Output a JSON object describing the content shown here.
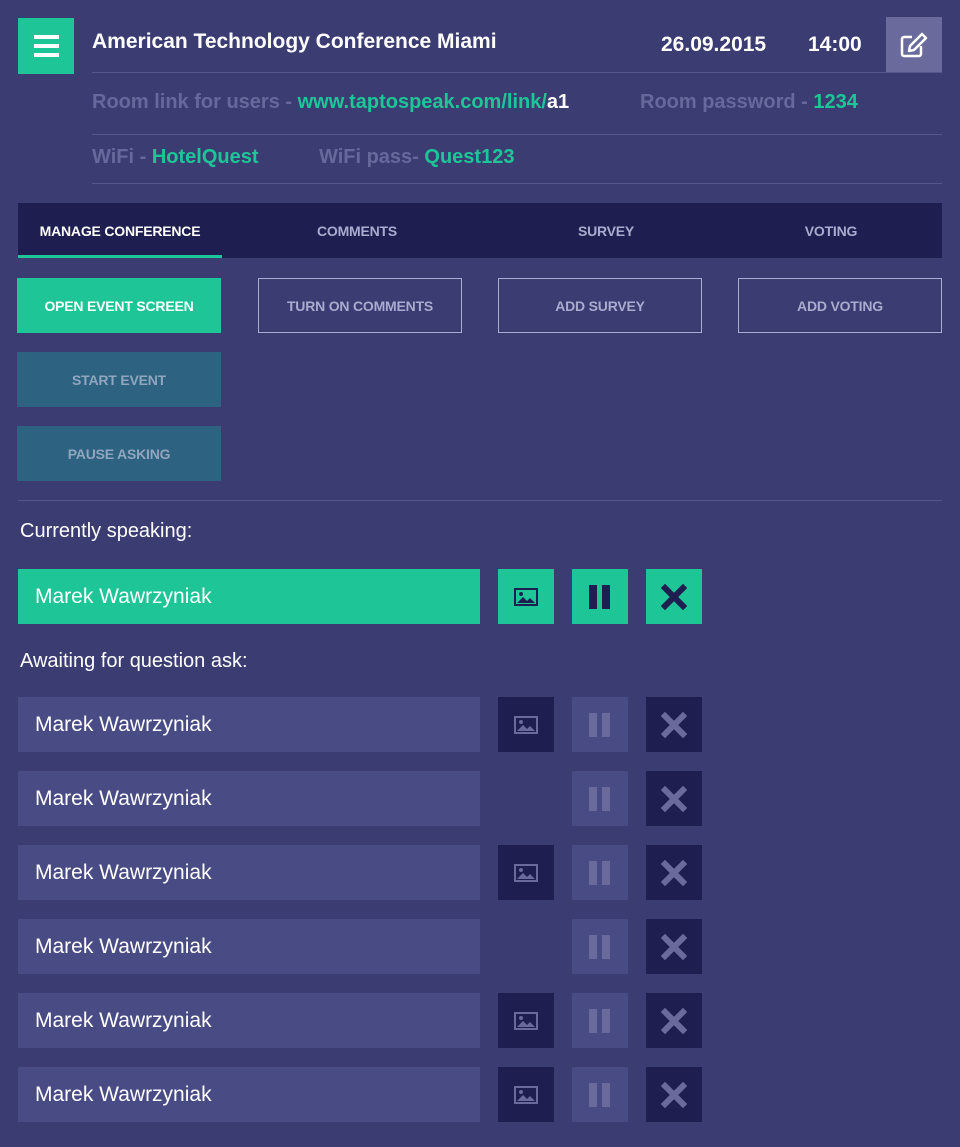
{
  "header": {
    "title": "American Technology Conference Miami",
    "date": "26.09.2015",
    "time": "14:00"
  },
  "info": {
    "room_link_label": "Room link for users - ",
    "room_link_url": "www.taptospeak.com/link/",
    "room_link_id": "a1",
    "room_password_label": "Room password - ",
    "room_password": "1234",
    "wifi_label": "WiFi - ",
    "wifi_name": "HotelQuest",
    "wifi_pass_label": "WiFi pass- ",
    "wifi_pass": "Quest123"
  },
  "tabs": [
    {
      "label": "MANAGE CONFERENCE",
      "active": true
    },
    {
      "label": "COMMENTS",
      "active": false
    },
    {
      "label": "SURVEY",
      "active": false
    },
    {
      "label": "VOTING",
      "active": false
    }
  ],
  "actions": {
    "open_event_screen": "OPEN EVENT SCREEN",
    "turn_on_comments": "TURN ON COMMENTS",
    "add_survey": "ADD SURVEY",
    "add_voting": "ADD VOTING",
    "start_event": "START EVENT",
    "pause_asking": "PAUSE ASKING"
  },
  "currently_speaking": {
    "label": "Currently speaking:",
    "name": "Marek Wawrzyniak"
  },
  "awaiting": {
    "label": "Awaiting for question ask:",
    "items": [
      {
        "name": "Marek Wawrzyniak",
        "has_image": true
      },
      {
        "name": "Marek Wawrzyniak",
        "has_image": false
      },
      {
        "name": "Marek Wawrzyniak",
        "has_image": true
      },
      {
        "name": "Marek Wawrzyniak",
        "has_image": false
      },
      {
        "name": "Marek Wawrzyniak",
        "has_image": true
      },
      {
        "name": "Marek Wawrzyniak",
        "has_image": true
      }
    ]
  },
  "icons": {
    "menu": "hamburger-menu-icon",
    "edit": "pencil-square-icon",
    "image": "image-icon",
    "pause": "pause-icon",
    "close": "close-icon"
  },
  "colors": {
    "background": "#3b3c72",
    "accent": "#1ec697",
    "dark": "#1e1f50",
    "row": "#494b84",
    "muted": "#67689c"
  }
}
